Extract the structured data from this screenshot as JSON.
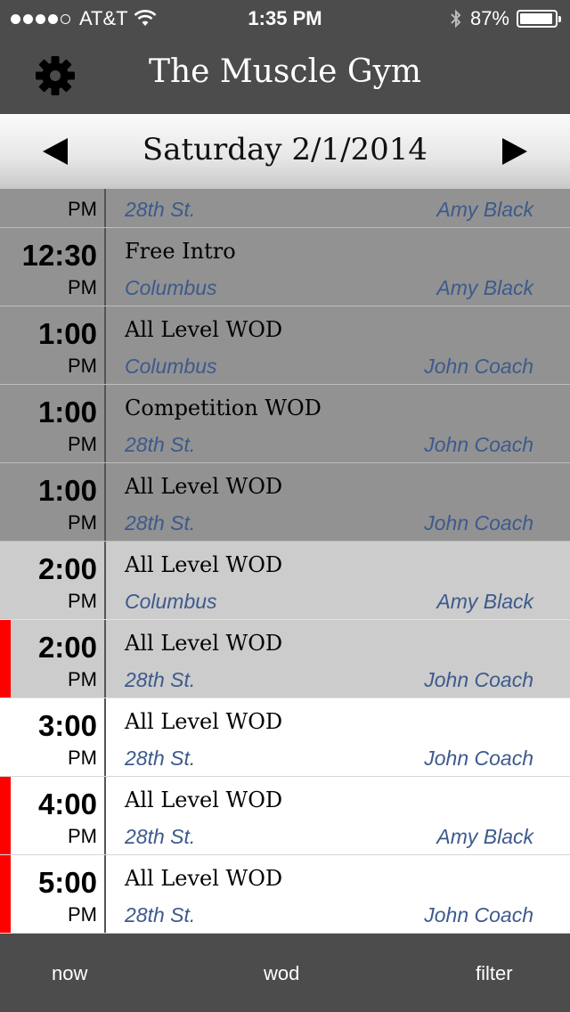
{
  "status_bar": {
    "carrier": "AT&T",
    "time": "1:35 PM",
    "battery": "87%",
    "battery_level": 0.87,
    "signal_bars": 4
  },
  "header": {
    "title": "The Muscle Gym"
  },
  "date_nav": {
    "date": "Saturday 2/1/2014"
  },
  "schedule": [
    {
      "time": "",
      "ampm": "PM",
      "class": "",
      "location": "28th St.",
      "coach": "Amy Black",
      "state": "past",
      "marked": false
    },
    {
      "time": "12:30",
      "ampm": "PM",
      "class": "Free Intro",
      "location": "Columbus",
      "coach": "Amy Black",
      "state": "past",
      "marked": false
    },
    {
      "time": "1:00",
      "ampm": "PM",
      "class": "All Level WOD",
      "location": "Columbus",
      "coach": "John Coach",
      "state": "past",
      "marked": false
    },
    {
      "time": "1:00",
      "ampm": "PM",
      "class": "Competition WOD",
      "location": "28th St.",
      "coach": "John Coach",
      "state": "past",
      "marked": false
    },
    {
      "time": "1:00",
      "ampm": "PM",
      "class": "All Level WOD",
      "location": "28th St.",
      "coach": "John Coach",
      "state": "past",
      "marked": false
    },
    {
      "time": "2:00",
      "ampm": "PM",
      "class": "All Level WOD",
      "location": "Columbus",
      "coach": "Amy Black",
      "state": "current",
      "marked": false
    },
    {
      "time": "2:00",
      "ampm": "PM",
      "class": "All Level WOD",
      "location": "28th St.",
      "coach": "John Coach",
      "state": "current",
      "marked": true
    },
    {
      "time": "3:00",
      "ampm": "PM",
      "class": "All Level WOD",
      "location": "28th St.",
      "coach": "John Coach",
      "state": "future",
      "marked": false
    },
    {
      "time": "4:00",
      "ampm": "PM",
      "class": "All Level WOD",
      "location": "28th St.",
      "coach": "Amy Black",
      "state": "future",
      "marked": true
    },
    {
      "time": "5:00",
      "ampm": "PM",
      "class": "All Level WOD",
      "location": "28th St.",
      "coach": "John Coach",
      "state": "future",
      "marked": true
    }
  ],
  "tab_bar": {
    "now": "now",
    "wod": "wod",
    "filter": "filter"
  },
  "colors": {
    "marker": "#ff0000",
    "link_text": "#3d5a8c",
    "past_row": "#929292",
    "current_row": "#cccccc",
    "future_row": "#ffffff",
    "bar": "#4c4c4c"
  },
  "icons": {
    "settings": "gear-icon",
    "previous": "triangle-left-icon",
    "next": "triangle-right-icon"
  }
}
